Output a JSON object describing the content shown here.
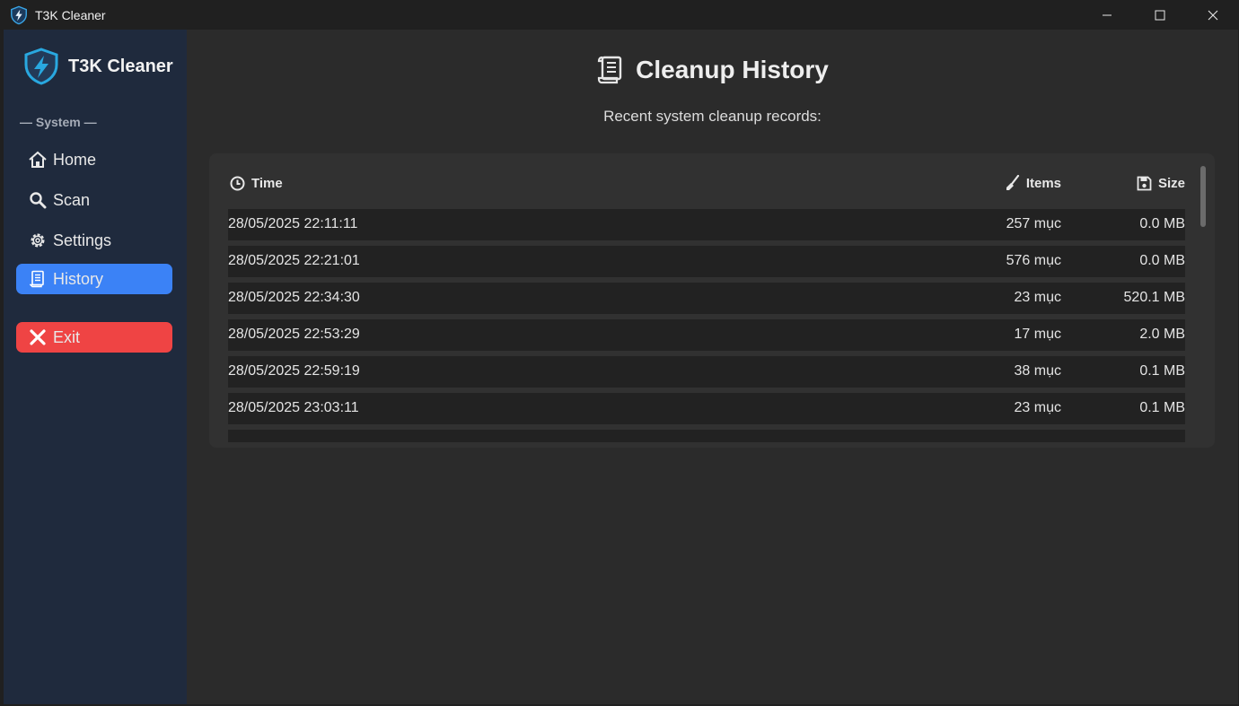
{
  "window": {
    "title": "T3K Cleaner"
  },
  "sidebar": {
    "brand": "T3K Cleaner",
    "section": "— System —",
    "items": [
      {
        "label": "Home",
        "icon": "home-icon"
      },
      {
        "label": "Scan",
        "icon": "search-icon"
      },
      {
        "label": "Settings",
        "icon": "gear-icon"
      },
      {
        "label": "History",
        "icon": "scroll-icon",
        "active": true
      }
    ],
    "exit": {
      "label": "Exit",
      "icon": "close-x-icon"
    }
  },
  "main": {
    "title": "Cleanup History",
    "subtitle": "Recent system cleanup records:",
    "table": {
      "headers": {
        "time": "Time",
        "items": "Items",
        "size": "Size"
      },
      "rows": [
        {
          "time": "28/05/2025 22:11:11",
          "items": "257 mục",
          "size": "0.0 MB"
        },
        {
          "time": "28/05/2025 22:21:01",
          "items": "576 mục",
          "size": "0.0 MB"
        },
        {
          "time": "28/05/2025 22:34:30",
          "items": "23 mục",
          "size": "520.1 MB"
        },
        {
          "time": "28/05/2025 22:53:29",
          "items": "17 mục",
          "size": "2.0 MB"
        },
        {
          "time": "28/05/2025 22:59:19",
          "items": "38 mục",
          "size": "0.1 MB"
        },
        {
          "time": "28/05/2025 23:03:11",
          "items": "23 mục",
          "size": "0.1 MB"
        }
      ]
    }
  },
  "colors": {
    "sidebar_bg": "#1f2a3d",
    "main_bg": "#2b2b2b",
    "active": "#3b82f6",
    "exit": "#ef4444",
    "brand_accent": "#29a8e0"
  }
}
